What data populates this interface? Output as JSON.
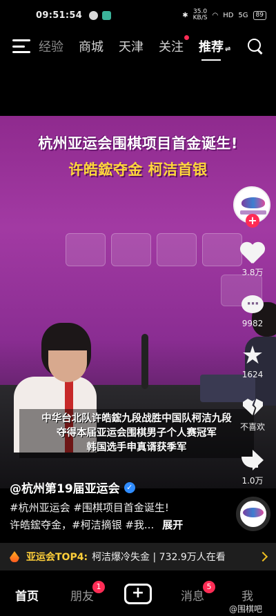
{
  "status_bar": {
    "time": "09:51:54",
    "net_speed_value": "35.0",
    "net_speed_unit": "KB/S",
    "hd": "HD",
    "signal": "5G",
    "battery": "89"
  },
  "top_tabs": {
    "items": [
      {
        "label": "经验"
      },
      {
        "label": "商城"
      },
      {
        "label": "天津"
      },
      {
        "label": "关注"
      },
      {
        "label": "推荐"
      }
    ],
    "active": "推荐"
  },
  "video": {
    "headline": "杭州亚运会围棋项目首金诞生!",
    "subline": "许皓鋐夺金 柯洁首银",
    "caption_lines": [
      "中华台北队许皓鋐九段战胜中国队柯洁九段",
      "夺得本届亚运会围棋男子个人赛冠军",
      "韩国选手申真谞获季军"
    ]
  },
  "actions": {
    "likes": "3.8万",
    "comments": "9982",
    "favorites": "1624",
    "dislike_label": "不喜欢",
    "shares": "1.0万",
    "follow_symbol": "+"
  },
  "post": {
    "author": "@杭州第19届亚运会",
    "description_line1": "#杭州亚运会 #围棋项目首金诞生!",
    "description_line2": "许皓鋐夺金，#柯洁摘银 #我...",
    "expand_label": "展开"
  },
  "hot_bar": {
    "topic": "亚运会TOP4:",
    "text": "柯洁爆冷失金 | 732.9万人在看"
  },
  "bottom_nav": {
    "home": "首页",
    "friends": "朋友",
    "friends_badge": "1",
    "create": "+",
    "messages": "消息",
    "messages_badge": "5",
    "me": "我"
  },
  "watermark": "@围棋吧",
  "colors": {
    "accent_red": "#ff2c55",
    "hot_yellow": "#ffcf3a",
    "video_purple": "#a23aa3"
  }
}
